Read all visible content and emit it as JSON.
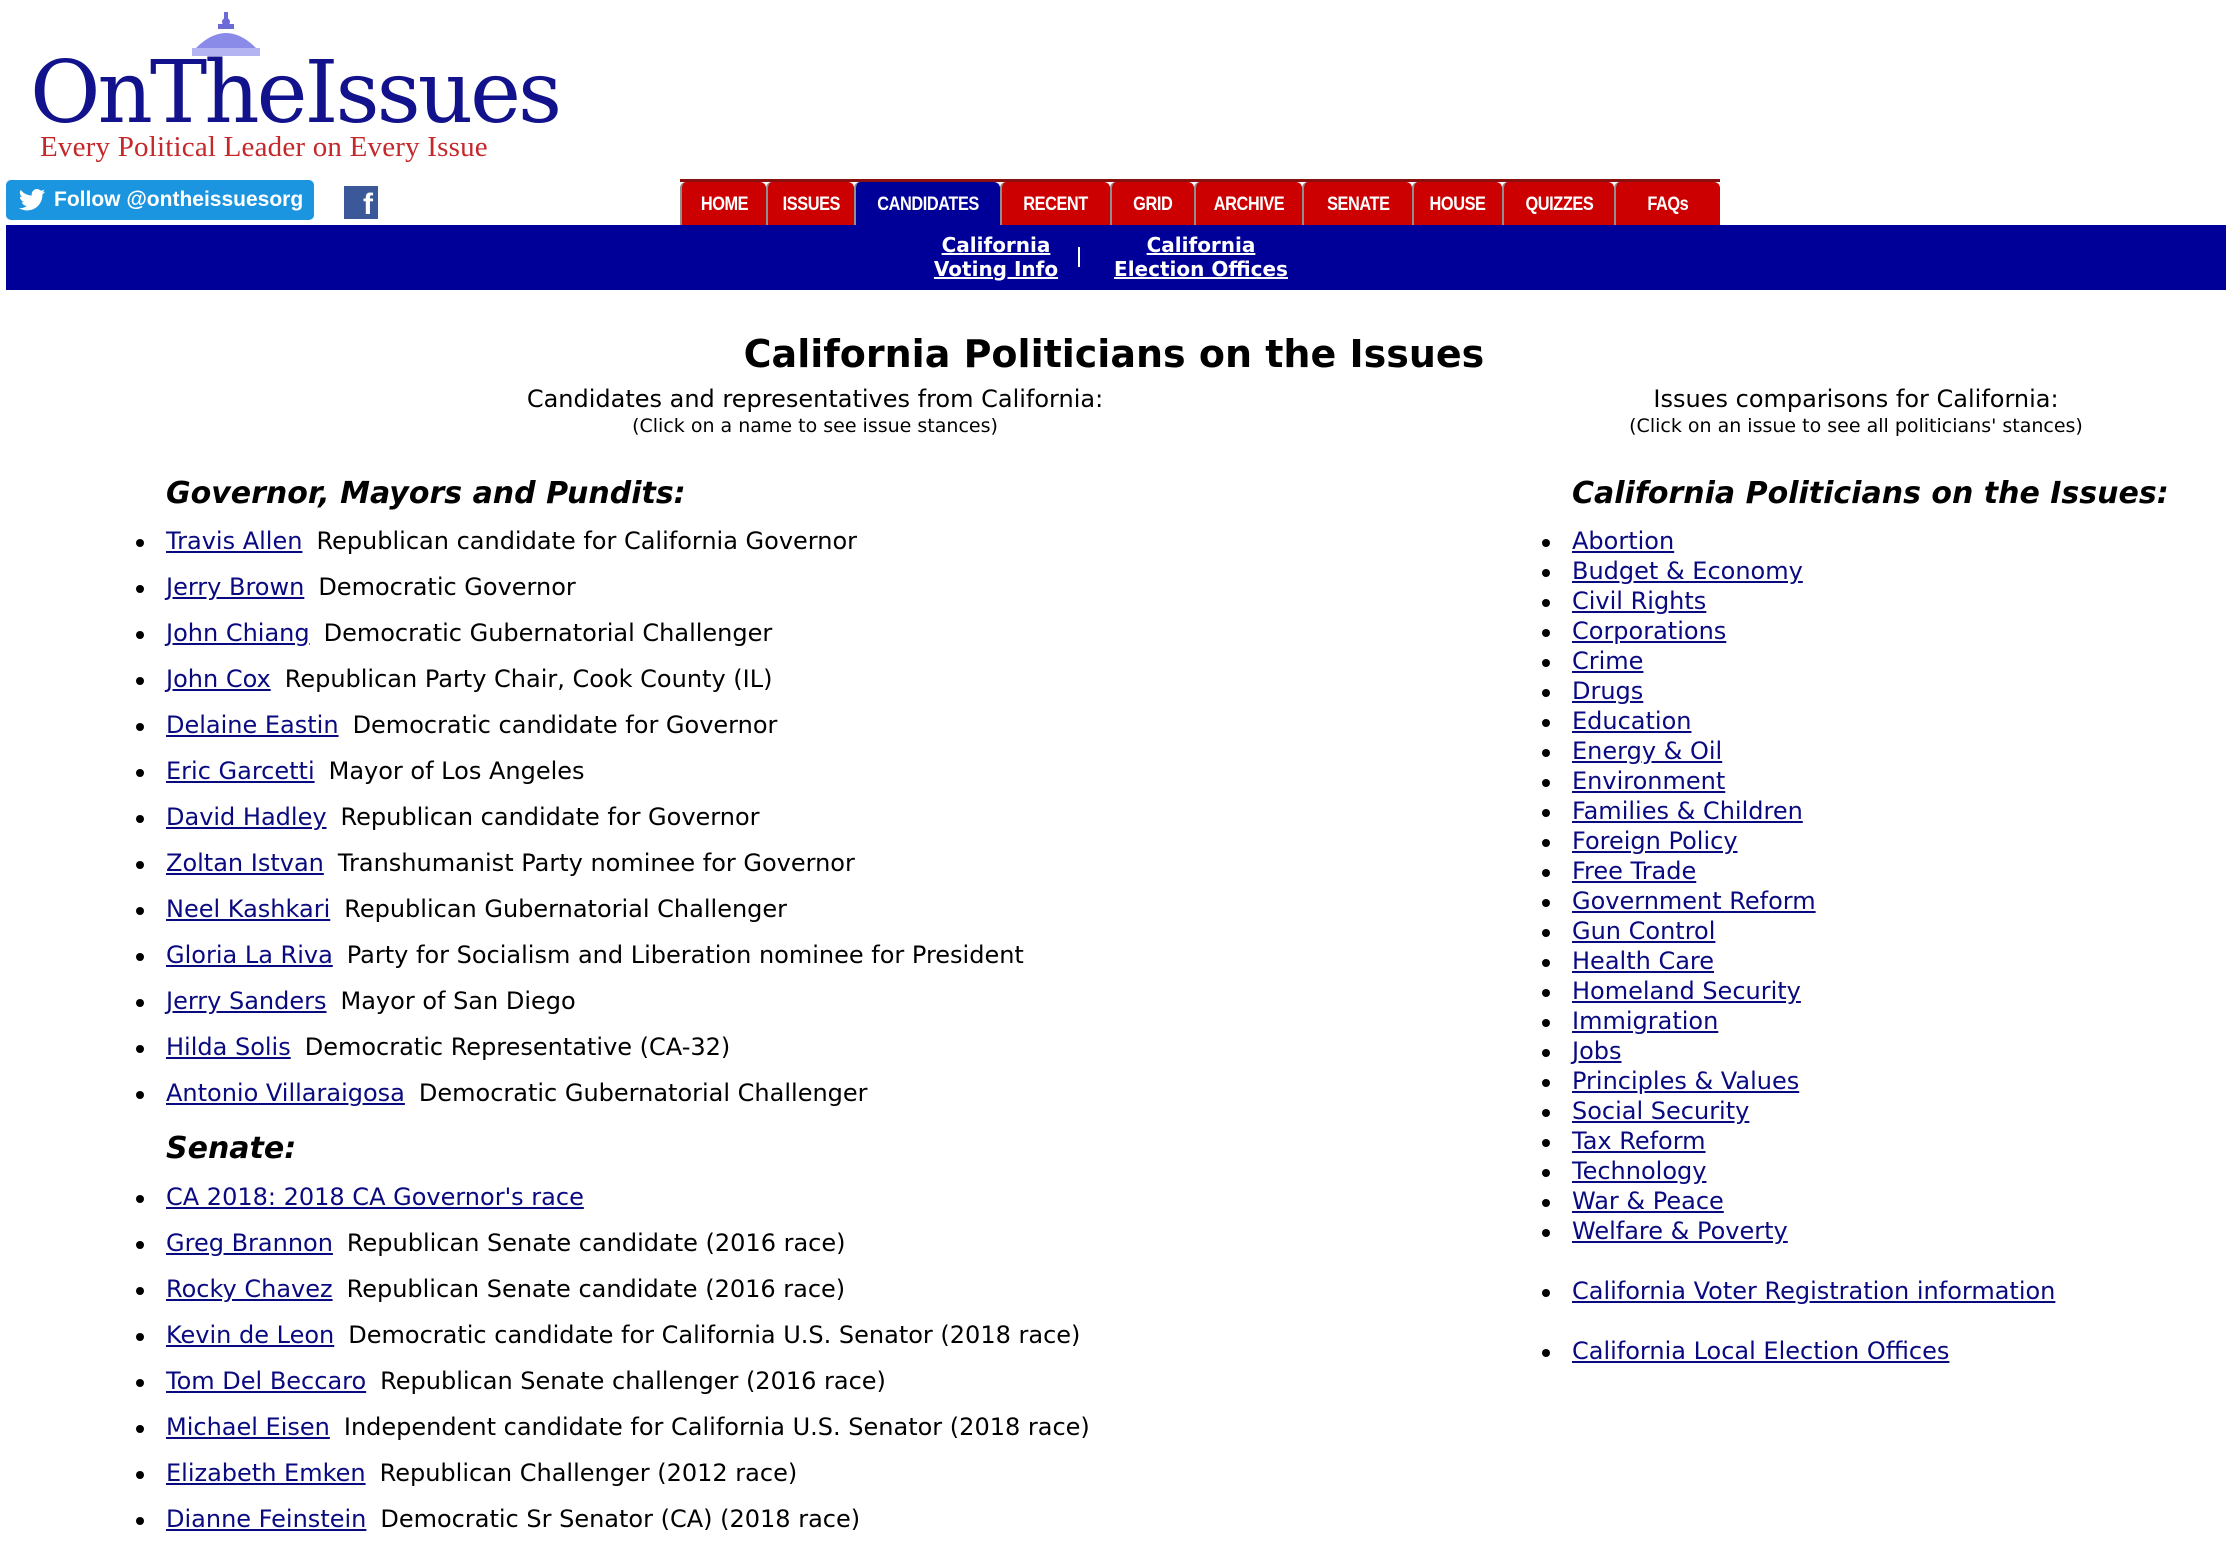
{
  "header": {
    "logo_text": "OnTheIssues",
    "logo_tagline": "Every Political Leader on Every Issue",
    "twitter_label": "Follow @ontheissuesorg",
    "facebook_glyph": "f"
  },
  "nav": {
    "tabs": [
      {
        "label": "HOME",
        "active": false
      },
      {
        "label": "ISSUES",
        "active": false
      },
      {
        "label": "CANDIDATES",
        "active": true
      },
      {
        "label": "RECENT",
        "active": false
      },
      {
        "label": "GRID",
        "active": false
      },
      {
        "label": "ARCHIVE",
        "active": false
      },
      {
        "label": "SENATE",
        "active": false
      },
      {
        "label": "HOUSE",
        "active": false
      },
      {
        "label": "QUIZZES",
        "active": false
      },
      {
        "label": "FAQs",
        "active": false
      }
    ],
    "sublinks": [
      {
        "line1": "California",
        "line2": "Voting Info"
      },
      {
        "line1": "California",
        "line2": "Election Offices"
      }
    ]
  },
  "page": {
    "title": "California Politicians on the Issues",
    "left_subtitle": "Candidates and representatives from California:",
    "left_hint": "(Click on a name to see issue stances)",
    "right_subtitle": "Issues comparisons for California:",
    "right_hint": "(Click on an issue to see all politicians' stances)"
  },
  "governors": {
    "heading": "Governor, Mayors and Pundits:",
    "items": [
      {
        "name": "Travis Allen",
        "desc": "Republican candidate for California Governor"
      },
      {
        "name": "Jerry Brown",
        "desc": "Democratic Governor"
      },
      {
        "name": "John Chiang",
        "desc": "Democratic Gubernatorial Challenger"
      },
      {
        "name": "John Cox",
        "desc": "Republican Party Chair, Cook County (IL)"
      },
      {
        "name": "Delaine Eastin",
        "desc": "Democratic candidate for Governor"
      },
      {
        "name": "Eric Garcetti",
        "desc": "Mayor of Los Angeles"
      },
      {
        "name": "David Hadley",
        "desc": "Republican candidate for Governor"
      },
      {
        "name": "Zoltan Istvan",
        "desc": "Transhumanist Party nominee for Governor"
      },
      {
        "name": "Neel Kashkari",
        "desc": "Republican Gubernatorial Challenger"
      },
      {
        "name": "Gloria La Riva",
        "desc": "Party for Socialism and Liberation nominee for President"
      },
      {
        "name": "Jerry Sanders",
        "desc": "Mayor of San Diego"
      },
      {
        "name": "Hilda Solis",
        "desc": "Democratic Representative (CA-32)"
      },
      {
        "name": "Antonio Villaraigosa",
        "desc": "Democratic Gubernatorial Challenger"
      }
    ]
  },
  "senate": {
    "heading": "Senate:",
    "items": [
      {
        "name": "CA 2018: 2018 CA Governor's race",
        "desc": ""
      },
      {
        "name": "Greg Brannon",
        "desc": "Republican Senate candidate (2016 race)"
      },
      {
        "name": "Rocky Chavez",
        "desc": "Republican Senate candidate (2016 race)"
      },
      {
        "name": "Kevin de Leon",
        "desc": "Democratic candidate for California U.S. Senator (2018 race)"
      },
      {
        "name": "Tom Del Beccaro",
        "desc": "Republican Senate challenger (2016 race)"
      },
      {
        "name": "Michael Eisen",
        "desc": "Independent candidate for California U.S. Senator (2018 race)"
      },
      {
        "name": "Elizabeth Emken",
        "desc": "Republican Challenger (2012 race)"
      },
      {
        "name": "Dianne Feinstein",
        "desc": "Democratic Sr Senator (CA) (2018 race)"
      }
    ]
  },
  "issues": {
    "heading": "California Politicians on the Issues:",
    "items": [
      "Abortion",
      "Budget & Economy",
      "Civil Rights",
      "Corporations",
      "Crime",
      "Drugs",
      "Education",
      "Energy & Oil",
      "Environment",
      "Families & Children",
      "Foreign Policy",
      "Free Trade",
      "Government Reform",
      "Gun Control",
      "Health Care",
      "Homeland Security",
      "Immigration",
      "Jobs",
      "Principles & Values",
      "Social Security",
      "Tax Reform",
      "Technology",
      "War & Peace",
      "Welfare & Poverty"
    ],
    "extra_links": [
      "California Voter Registration information",
      "California Local Election Offices"
    ]
  }
}
